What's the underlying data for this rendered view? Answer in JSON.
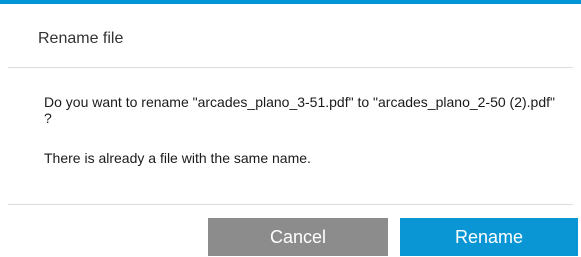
{
  "dialog": {
    "title": "Rename file",
    "message": "Do you want to rename \"arcades_plano_3-51.pdf\" to \"arcades_plano_2-50 (2).pdf\" ?",
    "note": "There is already a file with the same name.",
    "cancel_label": "Cancel",
    "rename_label": "Rename"
  },
  "colors": {
    "accent": "#0096d6",
    "cancel_button": "#8c8c8c",
    "rename_button": "#0a96d5"
  }
}
